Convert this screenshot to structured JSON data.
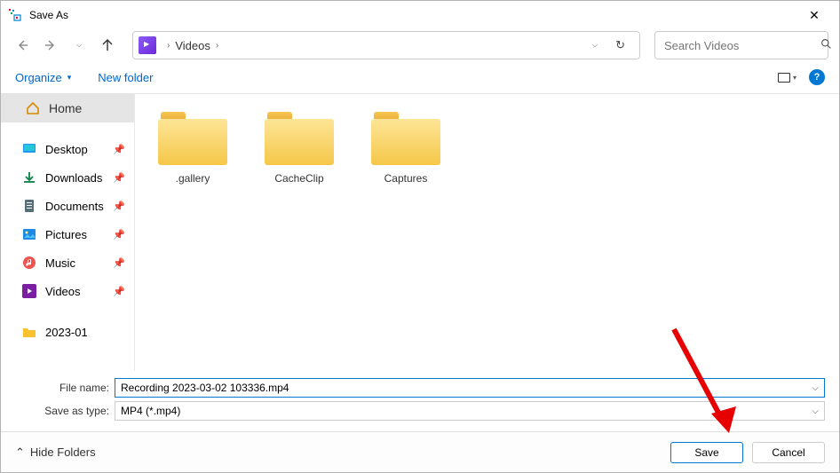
{
  "title": "Save As",
  "breadcrumb": {
    "location": "Videos"
  },
  "nav": {
    "dropdown_icon": "⌵",
    "refresh_icon": "↻"
  },
  "search": {
    "placeholder": "Search Videos"
  },
  "toolbar": {
    "organize": "Organize",
    "new_folder": "New folder"
  },
  "sidebar": {
    "home": "Home",
    "items": [
      {
        "label": "Desktop",
        "icon": "desktop"
      },
      {
        "label": "Downloads",
        "icon": "download"
      },
      {
        "label": "Documents",
        "icon": "document"
      },
      {
        "label": "Pictures",
        "icon": "pictures"
      },
      {
        "label": "Music",
        "icon": "music"
      },
      {
        "label": "Videos",
        "icon": "videos"
      },
      {
        "label": "2023-01",
        "icon": "folder"
      }
    ]
  },
  "folders": [
    {
      "name": ".gallery"
    },
    {
      "name": "CacheClip"
    },
    {
      "name": "Captures"
    }
  ],
  "form": {
    "filename_label": "File name:",
    "filename_value": "Recording 2023-03-02 103336.mp4",
    "filetype_label": "Save as type:",
    "filetype_value": "MP4 (*.mp4)"
  },
  "footer": {
    "hide_folders": "Hide Folders",
    "save": "Save",
    "cancel": "Cancel"
  }
}
